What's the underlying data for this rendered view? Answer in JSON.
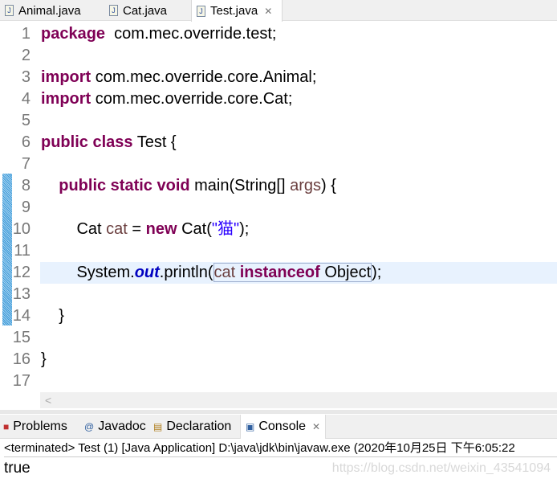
{
  "tabs": [
    {
      "label": "Animal.java",
      "active": false
    },
    {
      "label": "Cat.java",
      "active": false
    },
    {
      "label": "Test.java",
      "active": true
    }
  ],
  "editor": {
    "current_line": 12,
    "lines": [
      [
        [
          "k",
          "package"
        ],
        [
          "",
          "  com.mec.override.test;"
        ]
      ],
      [],
      [
        [
          "k",
          "import"
        ],
        [
          "",
          " com.mec.override.core.Animal;"
        ]
      ],
      [
        [
          "k",
          "import"
        ],
        [
          "",
          " com.mec.override.core.Cat;"
        ]
      ],
      [],
      [
        [
          "k",
          "public class"
        ],
        [
          "",
          " Test {"
        ]
      ],
      [],
      [
        [
          "",
          "    "
        ],
        [
          "k",
          "public static void"
        ],
        [
          "",
          " main(String[] "
        ],
        [
          "v",
          "args"
        ],
        [
          "",
          ") {"
        ]
      ],
      [],
      [
        [
          "",
          "        Cat "
        ],
        [
          "v",
          "cat"
        ],
        [
          "",
          " = "
        ],
        [
          "k",
          "new"
        ],
        [
          "",
          " Cat("
        ],
        [
          "s",
          "\"猫\""
        ],
        [
          "",
          ");"
        ]
      ],
      [],
      [
        [
          "",
          "        System."
        ],
        [
          "f",
          "out"
        ],
        [
          "",
          ".println("
        ],
        [
          "bv",
          "cat "
        ],
        [
          "bk",
          "instanceof"
        ],
        [
          "b",
          " Object"
        ],
        [
          "",
          ");"
        ]
      ],
      [],
      [
        [
          "",
          "    }"
        ]
      ],
      [],
      [
        [
          "",
          "}"
        ]
      ],
      []
    ]
  },
  "panel": {
    "tabs": [
      {
        "label": "Problems",
        "icon": "problems-icon"
      },
      {
        "label": "Javadoc",
        "icon": "at-icon"
      },
      {
        "label": "Declaration",
        "icon": "declaration-icon"
      },
      {
        "label": "Console",
        "icon": "console-icon",
        "active": true
      }
    ],
    "console_header": "<terminated> Test (1) [Java Application] D:\\java\\jdk\\bin\\javaw.exe  (2020年10月25日 下午6:05:22",
    "output": "true",
    "watermark": "https://blog.csdn.net/weixin_43541094"
  }
}
